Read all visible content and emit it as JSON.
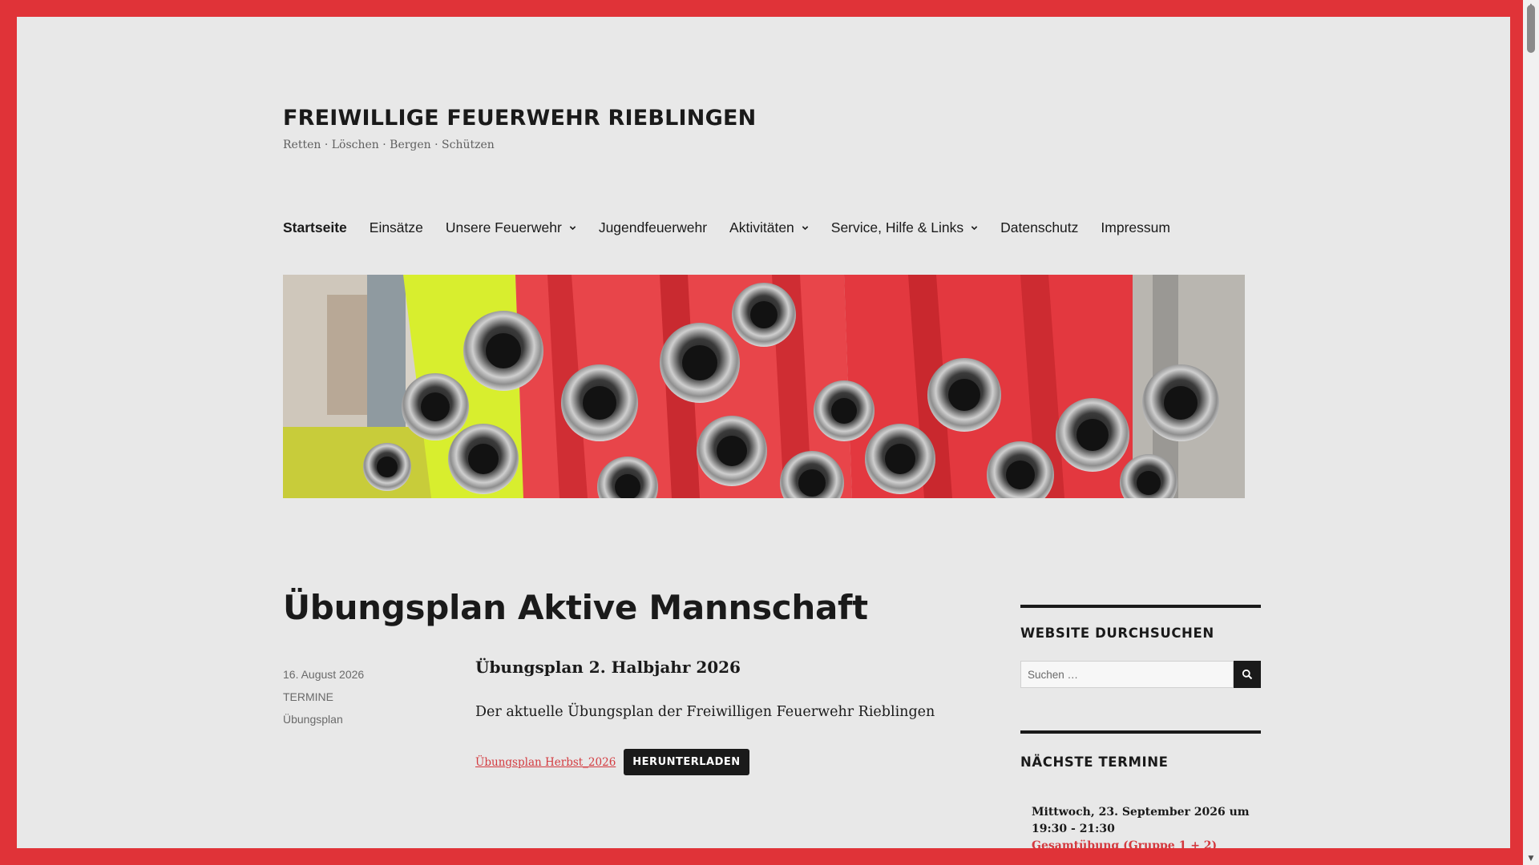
{
  "site": {
    "title": "FREIWILLIGE FEUERWEHR RIEBLINGEN",
    "tagline": "Retten · Löschen · Bergen · Schützen"
  },
  "nav": {
    "items": [
      {
        "label": "Startseite",
        "active": true,
        "has_submenu": false
      },
      {
        "label": "Einsätze",
        "active": false,
        "has_submenu": false
      },
      {
        "label": "Unsere Feuerwehr",
        "active": false,
        "has_submenu": true
      },
      {
        "label": "Jugendfeuerwehr",
        "active": false,
        "has_submenu": false
      },
      {
        "label": "Aktivitäten",
        "active": false,
        "has_submenu": true
      },
      {
        "label": "Service, Hilfe & Links",
        "active": false,
        "has_submenu": true
      },
      {
        "label": "Datenschutz",
        "active": false,
        "has_submenu": false
      },
      {
        "label": "Impressum",
        "active": false,
        "has_submenu": false
      }
    ]
  },
  "post": {
    "title": "Übungsplan Aktive Mannschaft",
    "date": "16. August 2026",
    "category": "TERMINE",
    "tag": "Übungsplan",
    "heading": "Übungsplan 2. Halbjahr 2026",
    "text": "Der aktuelle Übungsplan der Freiwilligen Feuerwehr Rieblingen",
    "file_link": "Übungsplan Herbst_2026",
    "download_label": "HERUNTERLADEN"
  },
  "sidebar": {
    "search": {
      "title": "WEBSITE DURCHSUCHEN",
      "placeholder": "Suchen …"
    },
    "events": {
      "title": "NÄCHSTE TERMINE",
      "items": [
        {
          "date": "Mittwoch, 23. September 2026 um 19:30 - 21:30",
          "title": "Gesamtübung (Gruppe 1 + 2)"
        }
      ]
    }
  },
  "colors": {
    "frame": "#e03338",
    "page_bg": "#e8e8e8",
    "text": "#1a1a1a",
    "accent_link": "#d33a3f"
  },
  "icons": [
    "chevron-down-icon",
    "search-icon"
  ]
}
